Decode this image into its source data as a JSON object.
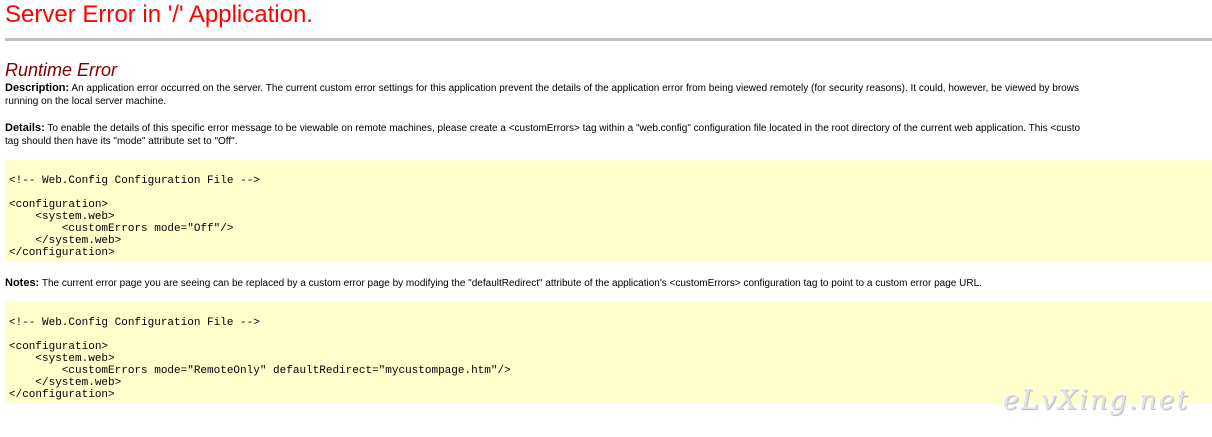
{
  "page": {
    "title": "Server Error in '/' Application.",
    "subtitle": "Runtime Error"
  },
  "description": {
    "label": "Description:",
    "text": " An application error occurred on the server. The current custom error settings for this application prevent the details of the application error from being viewed remotely (for security reasons). It could, however, be viewed by brows",
    "text_line2": "running on the local server machine."
  },
  "details": {
    "label": "Details:",
    "text": " To enable the details of this specific error message to be viewable on remote machines, please create a <customErrors> tag within a \"web.config\" configuration file located in the root directory of the current web application. This <custo",
    "text_line2": "tag should then have its \"mode\" attribute set to \"Off\"."
  },
  "code_block_1": {
    "text": "<!-- Web.Config Configuration File -->\n\n<configuration>\n    <system.web>\n        <customErrors mode=\"Off\"/>\n    </system.web>\n</configuration>"
  },
  "notes": {
    "label": "Notes:",
    "text": " The current error page you are seeing can be replaced by a custom error page by modifying the \"defaultRedirect\" attribute of the application's <customErrors> configuration tag to point to a custom error page URL."
  },
  "code_block_2": {
    "text": "<!-- Web.Config Configuration File -->\n\n<configuration>\n    <system.web>\n        <customErrors mode=\"RemoteOnly\" defaultRedirect=\"mycustompage.htm\"/>\n    </system.web>\n</configuration>"
  },
  "watermark": {
    "text": "eLvXing.net"
  },
  "colors": {
    "title": "#ff0000",
    "subtitle": "#800000",
    "rule": "#c0c0c0",
    "code_background": "#ffffcc"
  }
}
